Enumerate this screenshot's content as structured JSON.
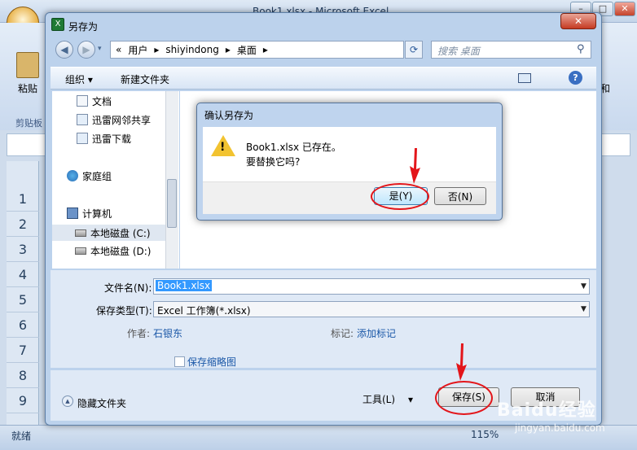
{
  "excel": {
    "title": "Book1.xlsx - Microsoft Excel",
    "paste_label": "粘贴",
    "clipboard_group": "剪贴板",
    "ribbon_right": "和",
    "row_numbers": [
      "1",
      "2",
      "3",
      "4",
      "5",
      "6",
      "7",
      "8",
      "9"
    ],
    "status_ready": "就绪",
    "zoom": "115%"
  },
  "save_as": {
    "title": "另存为",
    "address_path": [
      "«",
      "用户",
      "▸",
      "shiyindong",
      "▸",
      "桌面",
      "▸"
    ],
    "search_placeholder": "搜索 桌面",
    "toolbar": {
      "organize": "组织 ▾",
      "new_folder": "新建文件夹"
    },
    "tree": [
      {
        "label": "文档",
        "icon": "document-icon"
      },
      {
        "label": "迅雷网邻共享",
        "icon": "share-icon"
      },
      {
        "label": "迅雷下载",
        "icon": "download-icon"
      },
      {
        "label": "家庭组",
        "icon": "homegroup-icon"
      },
      {
        "label": "计算机",
        "icon": "computer-icon"
      },
      {
        "label": "本地磁盘 (C:)",
        "icon": "drive-icon"
      },
      {
        "label": "本地磁盘 (D:)",
        "icon": "drive-icon"
      }
    ],
    "filename_label": "文件名(N):",
    "filename_value": "Book1.xlsx",
    "filetype_label": "保存类型(T):",
    "filetype_value": "Excel 工作簿(*.xlsx)",
    "author_label": "作者:",
    "author_value": "石银东",
    "tags_label": "标记:",
    "tags_value": "添加标记",
    "thumbnail_label": "保存缩略图",
    "hide_folders": "隐藏文件夹",
    "tools": "工具(L)",
    "save": "保存(S)",
    "cancel": "取消"
  },
  "confirm": {
    "title": "确认另存为",
    "message_line1": "Book1.xlsx 已存在。",
    "message_line2": "要替换它吗?",
    "yes": "是(Y)",
    "no": "否(N)"
  },
  "watermark": {
    "brand": "Baidu经验",
    "url": "jingyan.baidu.com"
  },
  "colors": {
    "annotation": "#e3151a",
    "selection": "#3399ff",
    "link": "#1b58a8"
  }
}
